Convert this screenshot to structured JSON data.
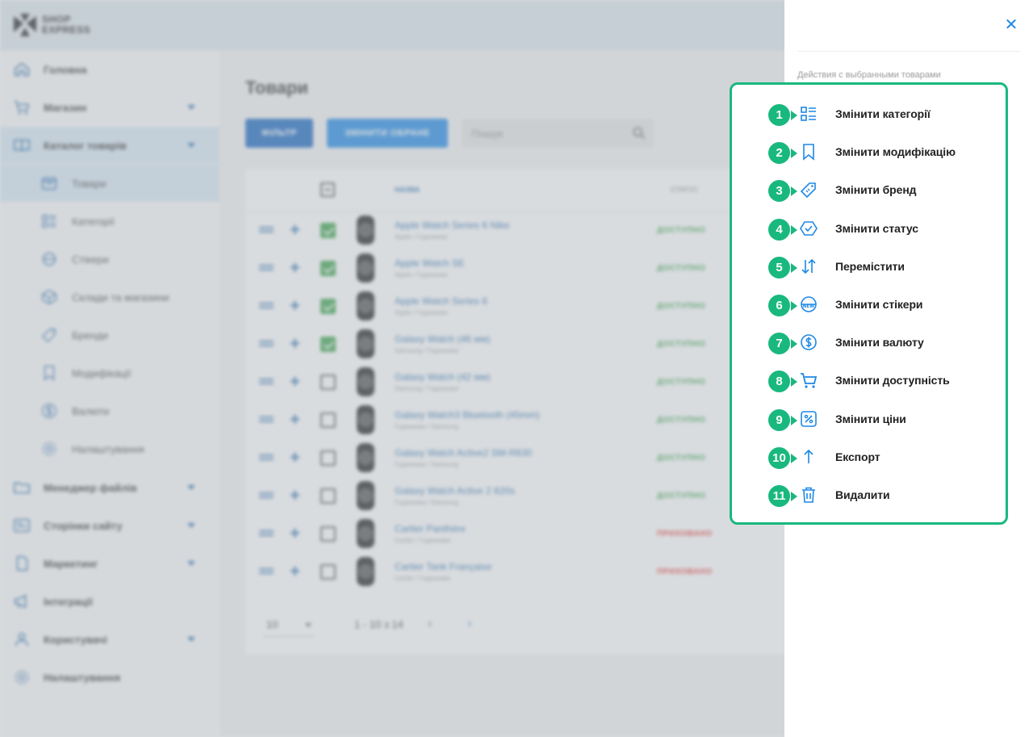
{
  "brand": {
    "line1": "SHOP",
    "line2": "EXPRESS"
  },
  "sidebar": {
    "items": [
      {
        "label": "Головна",
        "icon": "home-icon"
      },
      {
        "label": "Магазин",
        "icon": "cart-icon"
      },
      {
        "label": "Каталог товарів",
        "icon": "book-icon"
      },
      {
        "label": "Товари",
        "icon": "box-icon"
      },
      {
        "label": "Категорії",
        "icon": "category-icon"
      },
      {
        "label": "Стікери",
        "icon": "sticker-icon"
      },
      {
        "label": "Склади та магазини",
        "icon": "warehouse-icon"
      },
      {
        "label": "Бренди",
        "icon": "tag-icon"
      },
      {
        "label": "Модифікації",
        "icon": "bookmark-icon"
      },
      {
        "label": "Валюти",
        "icon": "dollar-icon"
      },
      {
        "label": "Налаштування",
        "icon": "gear-icon"
      },
      {
        "label": "Менеджер файлів",
        "icon": "folder-icon"
      },
      {
        "label": "Сторінки сайту",
        "icon": "pages-icon"
      },
      {
        "label": "Маркетинг",
        "icon": "marketing-icon"
      },
      {
        "label": "Інтеграції",
        "icon": "megaphone-icon"
      },
      {
        "label": "Користувачі",
        "icon": "users-icon"
      },
      {
        "label": "Налаштування",
        "icon": "gear-icon"
      }
    ]
  },
  "main": {
    "title": "Товари",
    "filter_label": "ФІЛЬТР",
    "change_label": "ЗМІНИТИ ОБРАНЕ",
    "search_placeholder": "Пошук",
    "col_name": "НАЗВА",
    "col_status": "СТАТУС",
    "rows": [
      {
        "name": "Apple Watch Series 6 Nike",
        "sub": "Apple / Годинники",
        "status": "ДОСТУПНО",
        "checked": true
      },
      {
        "name": "Apple Watch SE",
        "sub": "Apple / Годинники",
        "status": "ДОСТУПНО",
        "checked": true
      },
      {
        "name": "Apple Watch Series 6",
        "sub": "Apple / Годинники",
        "status": "ДОСТУПНО",
        "checked": true
      },
      {
        "name": "Galaxy Watch (46 мм)",
        "sub": "Samsung / Годинники",
        "status": "ДОСТУПНО",
        "checked": true
      },
      {
        "name": "Galaxy Watch (42 мм)",
        "sub": "Samsung / Годинники",
        "status": "ДОСТУПНО",
        "checked": false
      },
      {
        "name": "Galaxy Watch3 Bluetooth (45mm)",
        "sub": "Годинники / Samsung",
        "status": "ДОСТУПНО",
        "checked": false
      },
      {
        "name": "Galaxy Watch Active2 SM-R830",
        "sub": "Годинники / Samsung",
        "status": "ДОСТУПНО",
        "checked": false
      },
      {
        "name": "Galaxy Watch Active 2 820s",
        "sub": "Годинники / Samsung",
        "status": "ДОСТУПНО",
        "checked": false
      },
      {
        "name": "Cartier Panthère",
        "sub": "Cartier / Годинники",
        "status": "ПРИХОВАНО",
        "checked": false
      },
      {
        "name": "Cartier Tank Française",
        "sub": "Cartier / Годинники",
        "status": "ПРИХОВАНО",
        "checked": false
      }
    ],
    "per_page": "10",
    "range": "1 - 10 з 14"
  },
  "panel": {
    "caption": "Действия с выбранными товарами",
    "actions": [
      {
        "num": "1",
        "label": "Змінити категорії",
        "icon": "list-category-icon"
      },
      {
        "num": "2",
        "label": "Змінити модифікацію",
        "icon": "bookmark-icon"
      },
      {
        "num": "3",
        "label": "Змінити бренд",
        "icon": "price-tag-icon"
      },
      {
        "num": "4",
        "label": "Змінити статус",
        "icon": "check-badge-icon"
      },
      {
        "num": "5",
        "label": "Перемістити",
        "icon": "swap-vertical-icon"
      },
      {
        "num": "6",
        "label": "Змінити стікери",
        "icon": "new-sticker-icon"
      },
      {
        "num": "7",
        "label": "Змінити валюту",
        "icon": "dollar-circle-icon"
      },
      {
        "num": "8",
        "label": "Змінити доступність",
        "icon": "cart-icon"
      },
      {
        "num": "9",
        "label": "Змінити ціни",
        "icon": "percent-icon"
      },
      {
        "num": "10",
        "label": "Експорт",
        "icon": "arrow-up-icon"
      },
      {
        "num": "11",
        "label": "Видалити",
        "icon": "trash-icon"
      }
    ]
  },
  "colors": {
    "accent": "#1e88e5",
    "highlight": "#19b87f",
    "available": "#3aa34a",
    "hidden": "#e53935"
  }
}
